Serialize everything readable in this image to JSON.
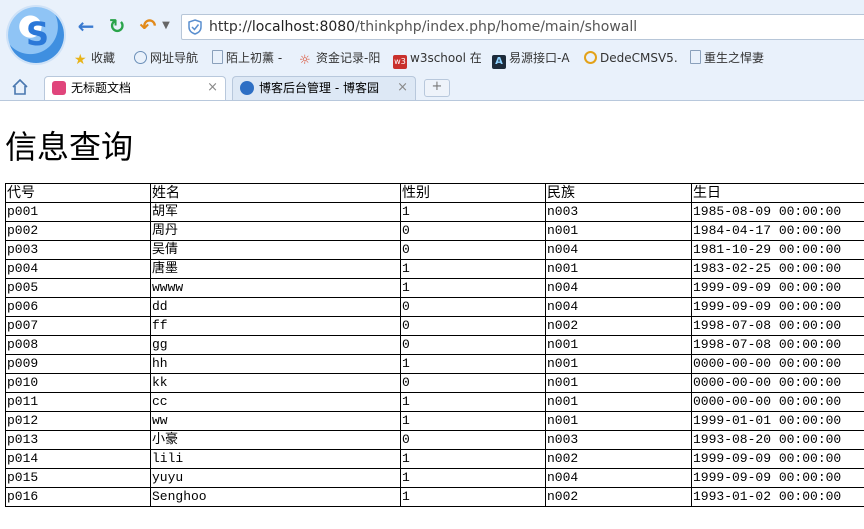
{
  "browser": {
    "url": {
      "scheme": "http://",
      "host": "localhost:8080",
      "path": "/thinkphp/index.php/home/main/showall"
    },
    "bookmarks": [
      {
        "label": "收藏",
        "icon": "star-icon"
      },
      {
        "label": "网址导航",
        "icon": "globe-icon"
      },
      {
        "label": "陌上初薰 -",
        "icon": "page-icon"
      },
      {
        "label": "资金记录-阳",
        "icon": "sun-icon"
      },
      {
        "label": "w3school 在",
        "icon": "w3-icon"
      },
      {
        "label": "易源接口-A",
        "icon": "a-icon"
      },
      {
        "label": "DedeCMSV5.",
        "icon": "dede-icon"
      },
      {
        "label": "重生之悍妻",
        "icon": "page-icon"
      }
    ],
    "tabs": [
      {
        "label": "无标题文档",
        "close": "×"
      },
      {
        "label": "博客后台管理 - 博客园",
        "close": "×"
      }
    ],
    "new_tab": "+"
  },
  "page": {
    "title": "信息查询",
    "columns": [
      "代号",
      "姓名",
      "性别",
      "民族",
      "生日"
    ],
    "rows": [
      [
        "p001",
        "胡军",
        "1",
        "n003",
        "1985-08-09 00:00:00"
      ],
      [
        "p002",
        "周丹",
        "0",
        "n001",
        "1984-04-17 00:00:00"
      ],
      [
        "p003",
        "吴倩",
        "0",
        "n004",
        "1981-10-29 00:00:00"
      ],
      [
        "p004",
        "唐墨",
        "1",
        "n001",
        "1983-02-25 00:00:00"
      ],
      [
        "p005",
        "wwww",
        "1",
        "n004",
        "1999-09-09 00:00:00"
      ],
      [
        "p006",
        "dd",
        "0",
        "n004",
        "1999-09-09 00:00:00"
      ],
      [
        "p007",
        "ff",
        "0",
        "n002",
        "1998-07-08 00:00:00"
      ],
      [
        "p008",
        "gg",
        "0",
        "n001",
        "1998-07-08 00:00:00"
      ],
      [
        "p009",
        "hh",
        "1",
        "n001",
        "0000-00-00 00:00:00"
      ],
      [
        "p010",
        "kk",
        "0",
        "n001",
        "0000-00-00 00:00:00"
      ],
      [
        "p011",
        "cc",
        "1",
        "n001",
        "0000-00-00 00:00:00"
      ],
      [
        "p012",
        "ww",
        "1",
        "n001",
        "1999-01-01 00:00:00"
      ],
      [
        "p013",
        "小豪",
        "0",
        "n003",
        "1993-08-20 00:00:00"
      ],
      [
        "p014",
        "lili",
        "1",
        "n002",
        "1999-09-09 00:00:00"
      ],
      [
        "p015",
        "yuyu",
        "1",
        "n004",
        "1999-09-09 00:00:00"
      ],
      [
        "p016",
        "Senghoo",
        "1",
        "n002",
        "1993-01-02 00:00:00"
      ]
    ]
  }
}
